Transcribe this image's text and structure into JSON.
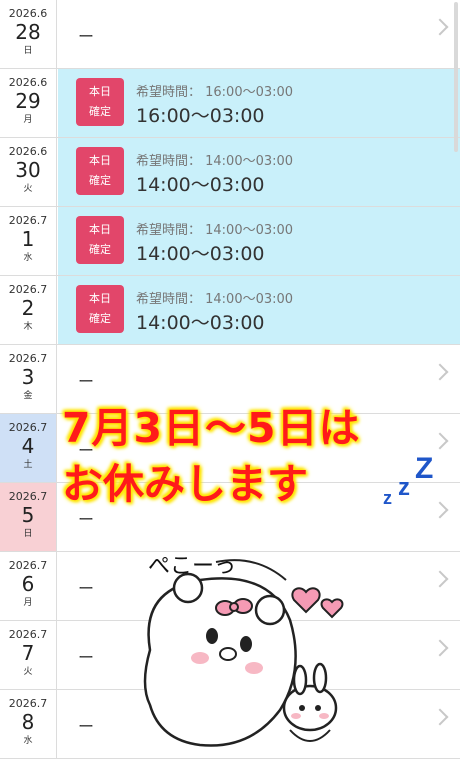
{
  "rows": [
    {
      "ym": "2026.6",
      "day": "28",
      "weekday": "日",
      "type": "empty",
      "dash": "ー"
    },
    {
      "ym": "2026.6",
      "day": "29",
      "weekday": "月",
      "type": "shift",
      "badge": [
        "本日",
        "確定"
      ],
      "wish": "希望時間： 16:00〜03:00",
      "time": "16:00〜03:00"
    },
    {
      "ym": "2026.6",
      "day": "30",
      "weekday": "火",
      "type": "shift",
      "badge": [
        "本日",
        "確定"
      ],
      "wish": "希望時間： 14:00〜03:00",
      "time": "14:00〜03:00"
    },
    {
      "ym": "2026.7",
      "day": "1",
      "weekday": "水",
      "type": "shift",
      "badge": [
        "本日",
        "確定"
      ],
      "wish": "希望時間： 14:00〜03:00",
      "time": "14:00〜03:00"
    },
    {
      "ym": "2026.7",
      "day": "2",
      "weekday": "木",
      "type": "shift",
      "badge": [
        "本日",
        "確定"
      ],
      "wish": "希望時間： 14:00〜03:00",
      "time": "14:00〜03:00"
    },
    {
      "ym": "2026.7",
      "day": "3",
      "weekday": "金",
      "type": "empty",
      "dash": "ー"
    },
    {
      "ym": "2026.7",
      "day": "4",
      "weekday": "土",
      "type": "empty",
      "dash": "ー",
      "tint": "sat"
    },
    {
      "ym": "2026.7",
      "day": "5",
      "weekday": "日",
      "type": "empty",
      "dash": "ー",
      "tint": "sun"
    },
    {
      "ym": "2026.7",
      "day": "6",
      "weekday": "月",
      "type": "empty",
      "dash": "ー"
    },
    {
      "ym": "2026.7",
      "day": "7",
      "weekday": "火",
      "type": "empty",
      "dash": "ー"
    },
    {
      "ym": "2026.7",
      "day": "8",
      "weekday": "水",
      "type": "empty",
      "dash": "ー"
    }
  ],
  "overlay": {
    "line1": "7月3日〜5日は",
    "line2": "お休みします",
    "zzz": [
      "z",
      "z",
      "Z"
    ],
    "peko": "ぺこーっ"
  },
  "colors": {
    "badge": "#e2466a",
    "shift_bg": "#c9f0fa",
    "sat_bg": "#cfe0f6",
    "sun_bg": "#f8d0d4",
    "notice_text": "#ff1a1a",
    "notice_glow": "#ffe500",
    "zzz": "#1f56c9",
    "bow": "#f59ab4"
  }
}
